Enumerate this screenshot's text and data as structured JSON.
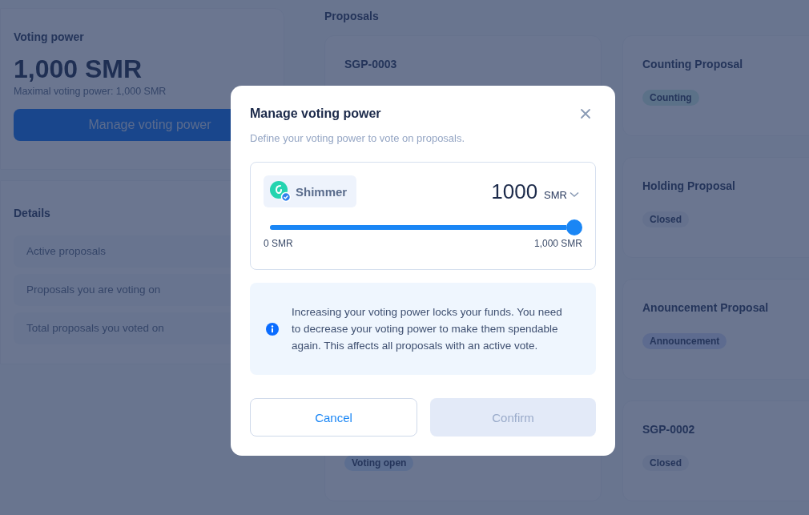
{
  "voting_power": {
    "heading": "Voting power",
    "amount": "1,000 SMR",
    "max_label": "Maximal voting power: 1,000 SMR",
    "button": "Manage voting power"
  },
  "details": {
    "heading": "Details",
    "items": [
      "Active proposals",
      "Proposals you are voting on",
      "Total proposals you voted on"
    ]
  },
  "proposals": {
    "heading": "Proposals",
    "column_1": [
      {
        "title": "SGP-0003"
      },
      {
        "status": "Voting open",
        "kind": "voting"
      }
    ],
    "column_2": [
      {
        "title": "Counting Proposal",
        "status": "Counting",
        "kind": "counting"
      },
      {
        "title": "Holding Proposal",
        "status": "Closed",
        "kind": "closed"
      },
      {
        "title": "Anouncement Proposal",
        "status": "Announcement",
        "kind": "announcement"
      },
      {
        "title": "SGP-0002",
        "status": "Closed",
        "kind": "closed"
      }
    ]
  },
  "modal": {
    "title": "Manage voting power",
    "subtitle": "Define your voting power to vote on proposals.",
    "token": "Shimmer",
    "amount": "1000",
    "unit": "SMR",
    "slider": {
      "level": 1,
      "min_label": "0 SMR",
      "max_label": "1,000 SMR"
    },
    "info": "Increasing your voting power locks your funds. You need to decrease your voting power to make them spendable again. This affects all proposals with an active vote.",
    "cancel": {
      "label": "Cancel"
    },
    "confirm": {
      "label": "Confirm",
      "disabled": true
    }
  }
}
